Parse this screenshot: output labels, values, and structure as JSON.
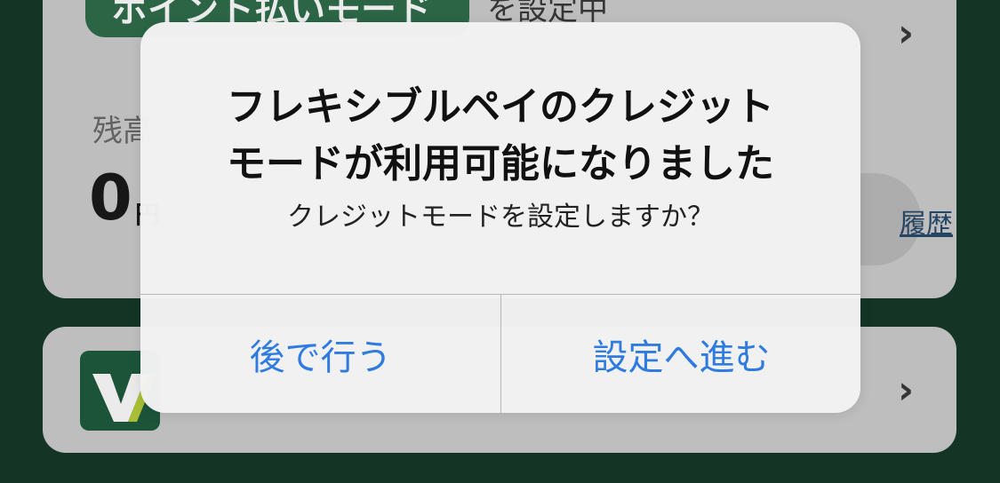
{
  "top_card": {
    "mode_pill_label": "ポイント払いモード",
    "mode_suffix": "を設定中",
    "balance_label": "残高",
    "balance_value": "0",
    "balance_unit": "円",
    "history_link": "履歴"
  },
  "bottom_card": {
    "logo_letter": "V"
  },
  "alert": {
    "title_line1": "フレキシブルペイのクレジット",
    "title_line2": "モードが利用可能になりました",
    "message": "クレジットモードを設定しますか？",
    "button_later": "後で行う",
    "button_proceed": "設定へ進む"
  },
  "colors": {
    "background": "#163a2a",
    "card": "#cfcfcf",
    "pill": "#2f6e4c",
    "alert_button": "#2f7be0",
    "logo_bg": "#1f5c3f",
    "logo_accent": "#b9cf3a"
  },
  "icons": [
    "chevron-right-icon",
    "vpoint-logo-icon"
  ]
}
